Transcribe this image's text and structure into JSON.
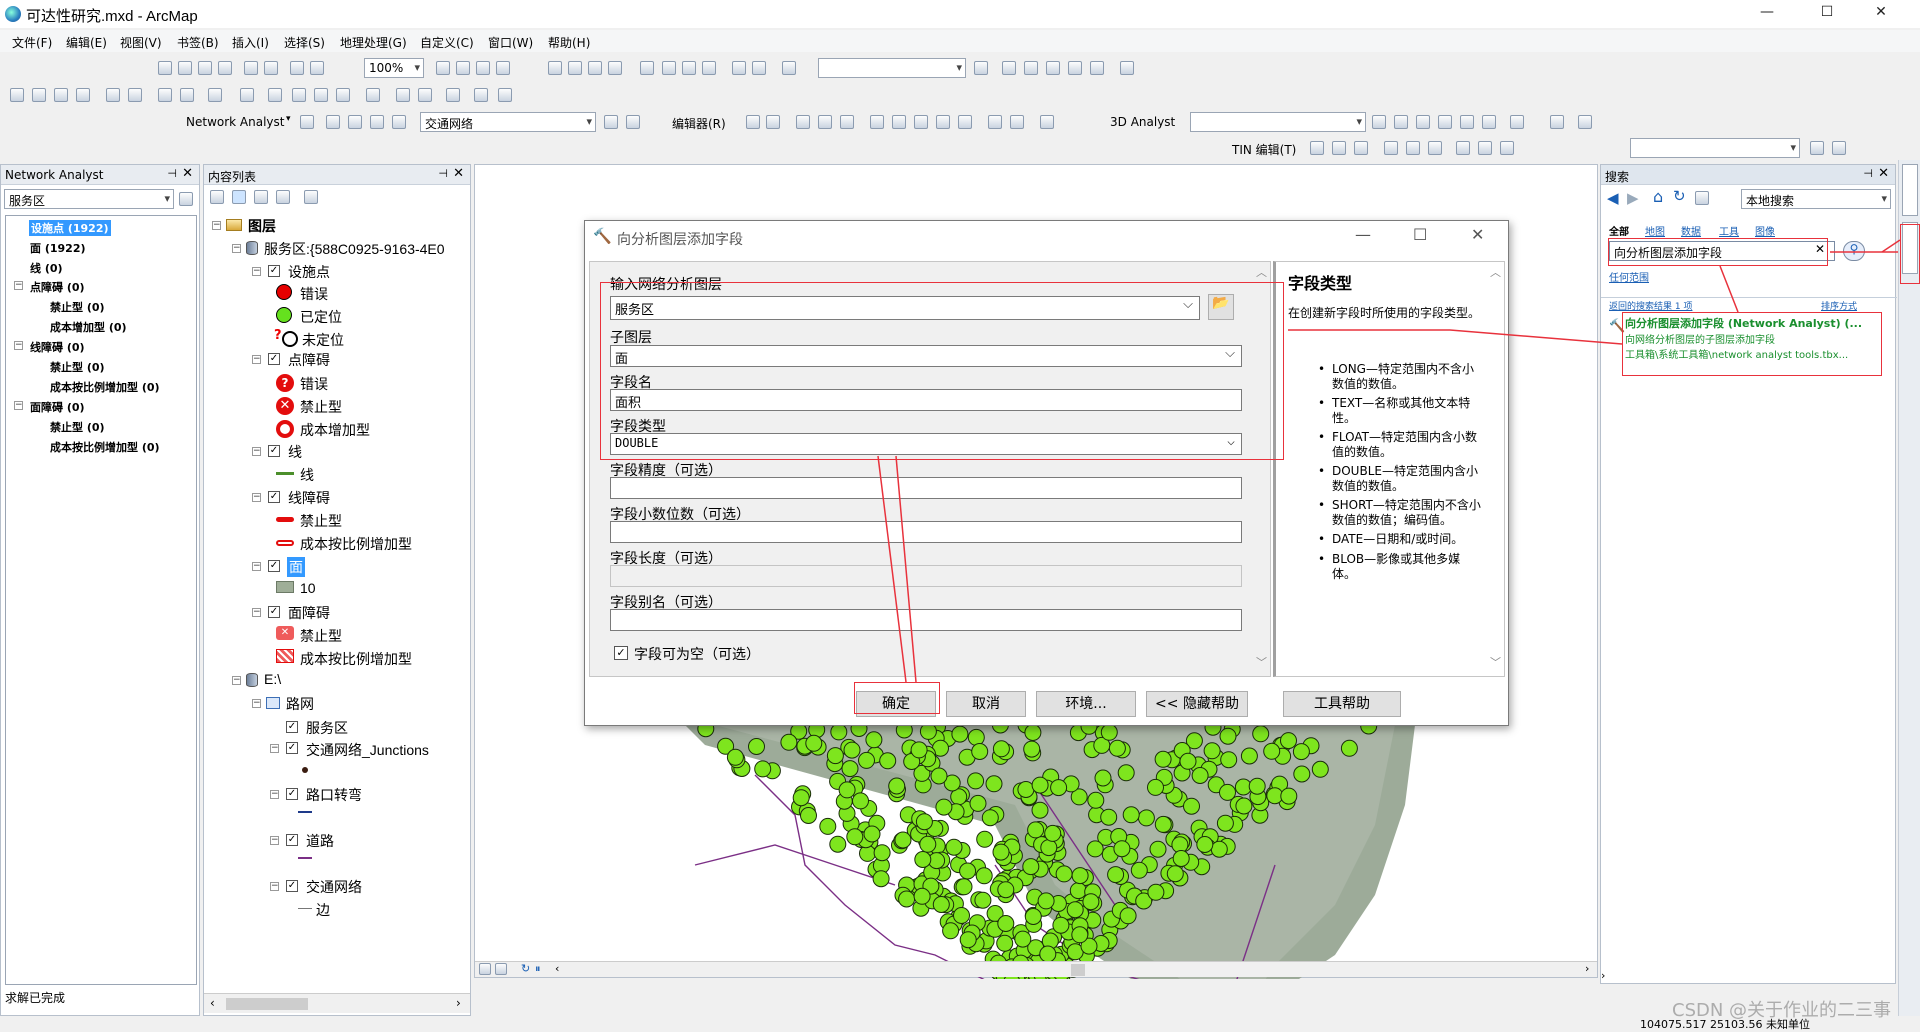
{
  "window": {
    "title": "可达性研究.mxd - ArcMap",
    "min": "—",
    "max": "☐",
    "close": "✕"
  },
  "menu": [
    "文件(F)",
    "编辑(E)",
    "视图(V)",
    "书签(B)",
    "插入(I)",
    "选择(S)",
    "地理处理(G)",
    "自定义(C)",
    "窗口(W)",
    "帮助(H)"
  ],
  "toolbar": {
    "zoom": "100%",
    "na_label": "Network Analyst",
    "network": "交通网络",
    "editor": "编辑器(R)",
    "analyst3d": "3D Analyst",
    "tin_edit": "TIN 编辑(T)"
  },
  "na_window": {
    "title": "Network Analyst",
    "layer": "服务区",
    "items": [
      {
        "label": "设施点 (1922)",
        "level": 0,
        "selected": true
      },
      {
        "label": "面 (1922)",
        "level": 0
      },
      {
        "label": "线 (0)",
        "level": 0
      },
      {
        "label": "点障碍 (0)",
        "level": 0,
        "group": true
      },
      {
        "label": "禁止型 (0)",
        "level": 1
      },
      {
        "label": "成本增加型 (0)",
        "level": 1
      },
      {
        "label": "线障碍 (0)",
        "level": 0,
        "group": true
      },
      {
        "label": "禁止型 (0)",
        "level": 1
      },
      {
        "label": "成本按比例增加型 (0)",
        "level": 1
      },
      {
        "label": "面障碍 (0)",
        "level": 0,
        "group": true
      },
      {
        "label": "禁止型 (0)",
        "level": 1
      },
      {
        "label": "成本按比例增加型 (0)",
        "level": 1
      }
    ],
    "status": "求解已完成"
  },
  "toc": {
    "title": "内容列表",
    "root": "图层",
    "layer_group": "服务区:{588C0925-9163-4E0",
    "facilities": "设施点",
    "fac_error": "错误",
    "fac_located": "已定位",
    "fac_unlocated": "未定位",
    "pb": "点障碍",
    "pb_error": "错误",
    "pb_restrict": "禁止型",
    "pb_cost": "成本增加型",
    "line": "线",
    "line_sym": "线",
    "lb": "线障碍",
    "lb_restrict": "禁止型",
    "lb_scaled": "成本按比例增加型",
    "poly": "面",
    "poly_sym": "10",
    "polyb": "面障碍",
    "polyb_restrict": "禁止型",
    "polyb_scaled": "成本按比例增加型",
    "drive": "E:\\",
    "dataset": "路网",
    "ds_area": "服务区",
    "ds_junc": "交通网络_Junctions",
    "ds_turn": "路口转弯",
    "ds_road": "道路",
    "ds_net": "交通网络",
    "ds_edge": "边"
  },
  "dialog": {
    "title": "向分析图层添加字段",
    "in_layer_label": "输入网络分析图层",
    "in_layer": "服务区",
    "sub_label": "子图层",
    "sub": "面",
    "fname_label": "字段名",
    "fname": "面积",
    "ftype_label": "字段类型",
    "ftype": "DOUBLE",
    "prec_label": "字段精度（可选）",
    "scale_label": "字段小数位数（可选）",
    "len_label": "字段长度（可选）",
    "alias_label": "字段别名（可选）",
    "nullable_label": "字段可为空（可选）",
    "ok": "确定",
    "cancel": "取消",
    "env": "环境...",
    "hide": "<< 隐藏帮助",
    "toolhelp": "工具帮助",
    "help_title": "字段类型",
    "help_intro": "在创建新字段时所使用的字段类型。",
    "help_items": [
      "LONG—特定范围内不含小数值的数值。",
      "TEXT—名称或其他文本特性。",
      "FLOAT—特定范围内含小数值的数值。",
      "DOUBLE—特定范围内含小数值的数值。",
      "SHORT—特定范围内不含小数值的数值；编码值。",
      "DATE—日期和/或时间。",
      "BLOB—影像或其他多媒体。"
    ]
  },
  "search": {
    "title": "搜索",
    "scope": "本地搜索",
    "tabs": [
      "全部",
      "地图",
      "数据",
      "工具",
      "图像"
    ],
    "query": "向分析图层添加字段",
    "any_extent": "任何范围",
    "results_count": "返回的搜索结果 1 项",
    "sort": "排序方式",
    "result_title": "向分析图层添加字段 (Network Analyst) (...",
    "result_desc": "向网络分析图层的子图层添加字段",
    "result_path": "工具箱\\系统工具箱\\network analyst tools.tbx..."
  },
  "statusbar": {
    "coords": "104075.517  25103.56 未知单位",
    "watermark": "CSDN @关于作业的二三事"
  },
  "colors": {
    "accent_red": "#e8323c",
    "selection": "#3399ff",
    "facility_green": "#7ee51e",
    "map_polygon": "#9fae98"
  }
}
